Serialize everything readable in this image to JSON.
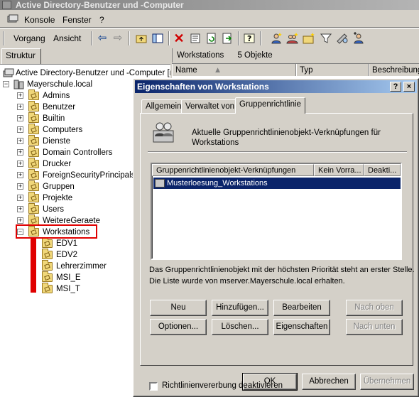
{
  "app": {
    "title": "Active Directory-Benutzer und -Computer"
  },
  "menu": {
    "konsole": "Konsole",
    "fenster": "Fenster",
    "help": "?"
  },
  "toolbar": {
    "vorgang": "Vorgang",
    "ansicht": "Ansicht"
  },
  "tree": {
    "tab_label": "Struktur",
    "root": "Active Directory-Benutzer und -Computer [m",
    "domain": "Mayerschule.local",
    "items": [
      {
        "label": "Admins"
      },
      {
        "label": "Benutzer"
      },
      {
        "label": "Builtin"
      },
      {
        "label": "Computers"
      },
      {
        "label": "Dienste"
      },
      {
        "label": "Domain Controllers"
      },
      {
        "label": "Drucker"
      },
      {
        "label": "ForeignSecurityPrincipals"
      },
      {
        "label": "Gruppen"
      },
      {
        "label": "Projekte"
      },
      {
        "label": "Users"
      },
      {
        "label": "WeitereGeraete"
      },
      {
        "label": "Workstations"
      }
    ],
    "children": [
      {
        "label": "EDV1"
      },
      {
        "label": "EDV2"
      },
      {
        "label": "Lehrerzimmer"
      },
      {
        "label": "MSI_E"
      },
      {
        "label": "MSI_T"
      }
    ]
  },
  "list": {
    "title": "Workstations",
    "count": "5 Objekte",
    "columns": {
      "name": "Name",
      "typ": "Typ",
      "beschreibung": "Beschreibung"
    }
  },
  "dialog": {
    "title": "Eigenschaften von Workstations",
    "title_help": "?",
    "title_close": "×",
    "tabs": [
      "Allgemein",
      "Verwaltet von",
      "Gruppenrichtlinie"
    ],
    "description_line1": "Aktuelle Gruppenrichtlinienobjekt-Verknüpfungen für",
    "description_line2": "Workstations",
    "list_columns": [
      "Gruppenrichtlinienobjekt-Verknüpfungen",
      "Kein Vorra...",
      "Deakti..."
    ],
    "selected_row": "Musterloesung_Workstations",
    "info_line1": "Das Gruppenrichtlinienobjekt mit der höchsten Priorität steht an erster Stelle.",
    "info_line2": "Die Liste wurde von mserver.Mayerschule.local erhalten.",
    "buttons": {
      "neu": "Neu",
      "hinzufuegen": "Hinzufügen...",
      "bearbeiten": "Bearbeiten",
      "nach_oben": "Nach oben",
      "optionen": "Optionen...",
      "loeschen": "Löschen...",
      "eigenschaften": "Eigenschaften",
      "nach_unten": "Nach unten"
    },
    "checkbox_label": "Richtlinienvererbung deaktivieren",
    "ok": "OK",
    "abbrechen": "Abbrechen",
    "uebernehmen": "Übernehmen"
  },
  "colors": {
    "selection": "#0a246a",
    "annotation": "#e00000",
    "dialog_title": "#0a246a"
  },
  "icons": [
    "console-icon",
    "back-arrow-icon",
    "forward-arrow-icon",
    "up-folder-icon",
    "properties-icon",
    "delete-icon",
    "refresh-icon",
    "export-icon",
    "help-icon",
    "new-user-icon",
    "new-group-icon",
    "new-ou-icon",
    "filter-icon",
    "find-icon",
    "gpo-icon"
  ]
}
